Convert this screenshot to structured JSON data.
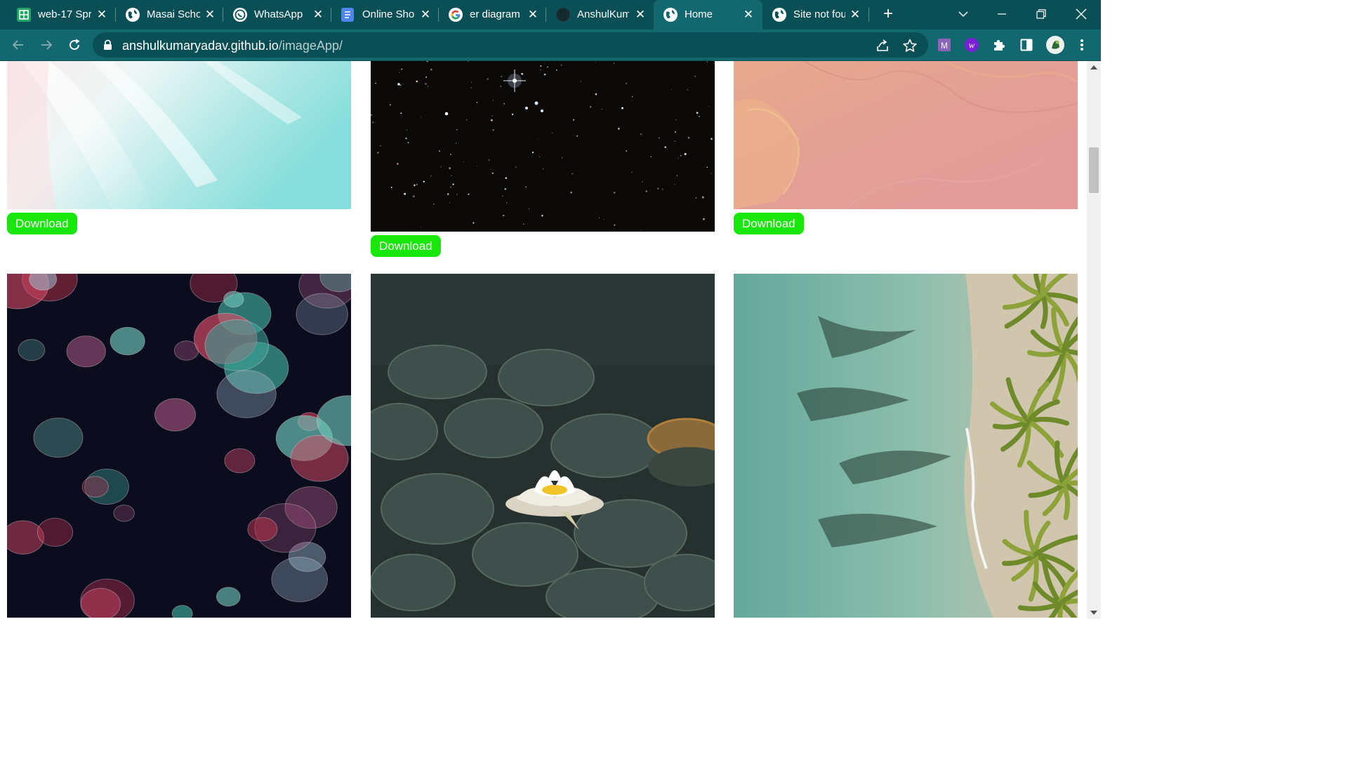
{
  "browser": {
    "tabs": [
      {
        "title": "web-17 Spr",
        "icon": "sheets-icon",
        "active": false
      },
      {
        "title": "Masai Scho",
        "icon": "globe-icon",
        "active": false
      },
      {
        "title": "WhatsApp",
        "icon": "whatsapp-icon",
        "active": false
      },
      {
        "title": "Online Sho",
        "icon": "docs-icon",
        "active": false
      },
      {
        "title": "er diagram",
        "icon": "google-icon",
        "active": false
      },
      {
        "title": "AnshulKum",
        "icon": "github-icon",
        "active": false
      },
      {
        "title": "Home",
        "icon": "globe-icon",
        "active": true
      },
      {
        "title": "Site not fou",
        "icon": "globe-icon",
        "active": false
      }
    ],
    "address_bar": {
      "domain": "anshulkumaryadav.github.io",
      "path": "/imageApp/"
    },
    "extensions": [
      "m-extension-icon",
      "w-extension-icon",
      "puzzle-icon",
      "side-panel-icon",
      "profile-avatar"
    ]
  },
  "gallery": {
    "download_label": "Download",
    "images": [
      {
        "name": "sky-clouds-image",
        "palette": "sky"
      },
      {
        "name": "starry-night-image",
        "palette": "stars"
      },
      {
        "name": "pink-sandstone-image",
        "palette": "rock"
      },
      {
        "name": "jellyfish-image",
        "palette": "jellyfish"
      },
      {
        "name": "water-lily-image",
        "palette": "lily"
      },
      {
        "name": "beach-palms-image",
        "palette": "beach"
      }
    ]
  },
  "colors": {
    "tab_strip": "#0b4f56",
    "toolbar": "#13676f",
    "download_button": "#17e80a"
  }
}
